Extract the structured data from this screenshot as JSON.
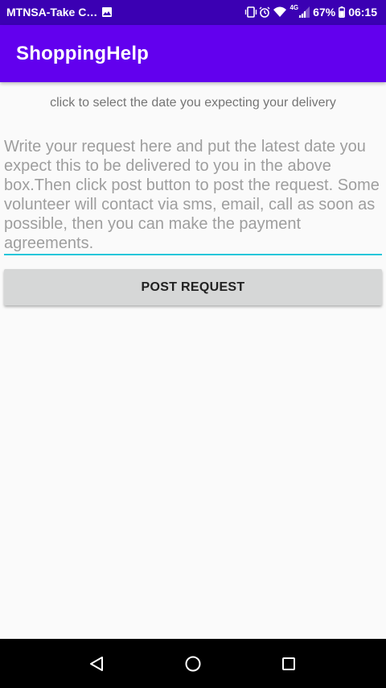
{
  "status_bar": {
    "carrier": "MTNSA-Take C…",
    "network_type": "4G",
    "battery_percent": "67%",
    "time": "06:15",
    "icons": [
      "image-icon",
      "vibrate-icon",
      "alarm-icon",
      "wifi-icon",
      "signal-icon",
      "battery-icon"
    ]
  },
  "app_bar": {
    "title": "ShoppingHelp"
  },
  "main": {
    "date_hint": "click to select the date you expecting your delivery",
    "request_placeholder": "Write your request here and put the latest date you expect this to be delivered to you in the above box.Then click post button to post the request. Some volunteer will contact via sms, email, call as soon as possible, then you can make the payment agreements.",
    "request_value": "",
    "post_button_label": "POST REQUEST"
  },
  "nav_bar": {
    "icons": [
      "back-icon",
      "home-icon",
      "recents-icon"
    ]
  },
  "colors": {
    "status_bar": "#3b00b3",
    "app_bar": "#6200ee",
    "input_underline": "#26c6da",
    "button": "#d6d7d7",
    "background": "#fafafa"
  }
}
